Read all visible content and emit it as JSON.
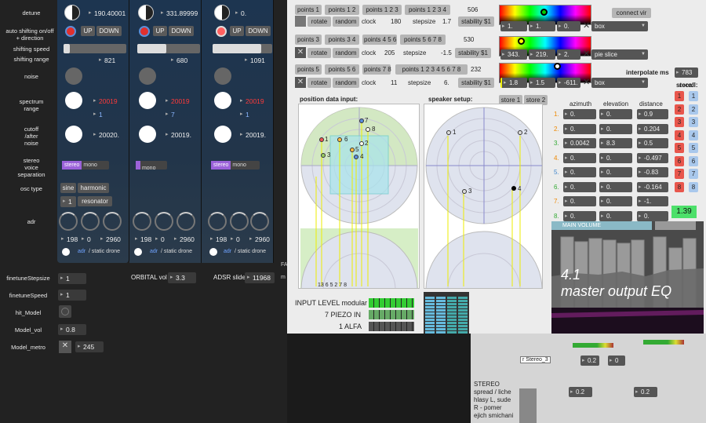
{
  "left": {
    "labels": {
      "detune": "detune",
      "auto": "auto shifting on/off\n+ direction",
      "speed": "shifting speed",
      "range": "shifting range",
      "noise": "noise",
      "spectrum": "spectrum\nrange",
      "cutoff": "cutoff\n/after\nnoise",
      "stereo": "stereo\nvoice\nseparation",
      "osc": "osc type",
      "adr": "adr"
    },
    "columns": [
      {
        "detune": "190.40001",
        "range": "821",
        "spec": "20019",
        "spec2": "1",
        "cutoff": "20020.",
        "n1": "198",
        "n2": "0",
        "n3": "2960"
      },
      {
        "detune": "331.89999",
        "range": "680",
        "spec": "20019",
        "spec2": "7",
        "cutoff": "20019.",
        "n1": "198",
        "n2": "0",
        "n3": "2960"
      },
      {
        "detune": "0.",
        "range": "1091",
        "spec": "20019",
        "spec2": "1",
        "cutoff": "20019.",
        "n1": "198",
        "n2": "0",
        "n3": "2960"
      }
    ],
    "up": "UP",
    "down": "DOWN",
    "stereo": "stereo",
    "mono": "mono",
    "sine": "sine",
    "harmonic": "harmonic",
    "resonator": "resonator",
    "osc_num": "1",
    "adr_txt": "adr",
    "static": "/ static drone",
    "bottom": {
      "fine_step_lbl": "finetuneStepsize",
      "fine_step": "1",
      "fine_speed_lbl": "finetuneSpeed",
      "fine_speed": "1",
      "hit_lbl": "hit_Model",
      "vol_lbl": "Model_vol",
      "vol": "0.8",
      "metro_lbl": "Model_metro",
      "metro": "245",
      "orbital_lbl": "ORBITAL vol",
      "orbital": "3.3",
      "adsr_lbl": "ADSR slide",
      "adsr": "11968"
    }
  },
  "window": {
    "rows": [
      {
        "b1": "points 1",
        "b2": "points 1 2",
        "b3": "points 1 2 3",
        "b4": "points 1 2 3 4",
        "val": "506"
      },
      {
        "b1": "points 3",
        "b2": "points 3 4",
        "b3": "points 4 5 6",
        "b4": "points 5 6 7 8",
        "val": "530"
      },
      {
        "b1": "points 5",
        "b2": "points 5 6",
        "b3": "points 7 8",
        "b4": "points 1 2 3 4 5 6 7 8",
        "val": "232"
      }
    ],
    "rotate": "rotate",
    "random": "random",
    "clock": "clock",
    "stepsize": "stepsize",
    "stability": "stability $1",
    "clocks": [
      "180",
      "205",
      "11"
    ],
    "steps": [
      "1.7",
      "-1.5",
      "6."
    ],
    "color_rows": [
      {
        "a": "1.",
        "b": "1.",
        "c": "0.",
        "sel": "box"
      },
      {
        "a": "343.",
        "b": "219.",
        "c": "2.",
        "sel": "pie slice"
      },
      {
        "a": "1.8",
        "b": "1.5",
        "c": "-611.",
        "sel": "box"
      }
    ],
    "connect": "connect vir",
    "interp_lbl": "interpolate ms",
    "interp": "783",
    "store_lbl": "store:",
    "recall_lbl": "recall:",
    "pos_lbl": "position data input:",
    "spk_lbl": "speaker setup:",
    "store1": "store 1",
    "store2": "store 2",
    "s1": "1",
    "s2": "2",
    "headers": [
      "azimuth",
      "elevation",
      "distance"
    ],
    "spk": [
      {
        "n": "1.",
        "az": "0.",
        "el": "0.",
        "d": "0.9"
      },
      {
        "n": "2.",
        "az": "0.",
        "el": "0.",
        "d": "0.204"
      },
      {
        "n": "3.",
        "az": "0.0042",
        "el": "8.3",
        "d": "0.5"
      },
      {
        "n": "4.",
        "az": "0.",
        "el": "0.",
        "d": "-0.497"
      },
      {
        "n": "5.",
        "az": "0.",
        "el": "0.",
        "d": "-0.83"
      },
      {
        "n": "6.",
        "az": "0.",
        "el": "0.",
        "d": "-0.164"
      },
      {
        "n": "7.",
        "az": "0.",
        "el": "0.",
        "d": "-1."
      },
      {
        "n": "8.",
        "az": "0.",
        "el": "0.",
        "d": "0."
      }
    ],
    "green_val": "1.39",
    "main_volume": "MAIN VOLUME",
    "eq_title": "4.1\nmaster output EQ",
    "input_level": "INPUT LEVEL modular",
    "piezo": "7 PIEZO IN",
    "alfa": "1 ALFA",
    "points_labels": [
      "1",
      "2",
      "3",
      "4",
      "5",
      "6",
      "7",
      "8"
    ],
    "bottom_pts": "13 6 5 2 7 8"
  },
  "patch": {
    "stereo_obj": "r Stereo_3",
    "v1": "0.2",
    "v2": "0",
    "v3": "0.2",
    "v4": "0.2",
    "comment": "STEREO\nspread / liche\nhlasy L, sude\nR - pomer\nejich smichani",
    "fa": "FA",
    "m": "m"
  },
  "colors": {
    "accent": "#9b62d9",
    "red": "#e0302e",
    "green": "#4de06a"
  }
}
